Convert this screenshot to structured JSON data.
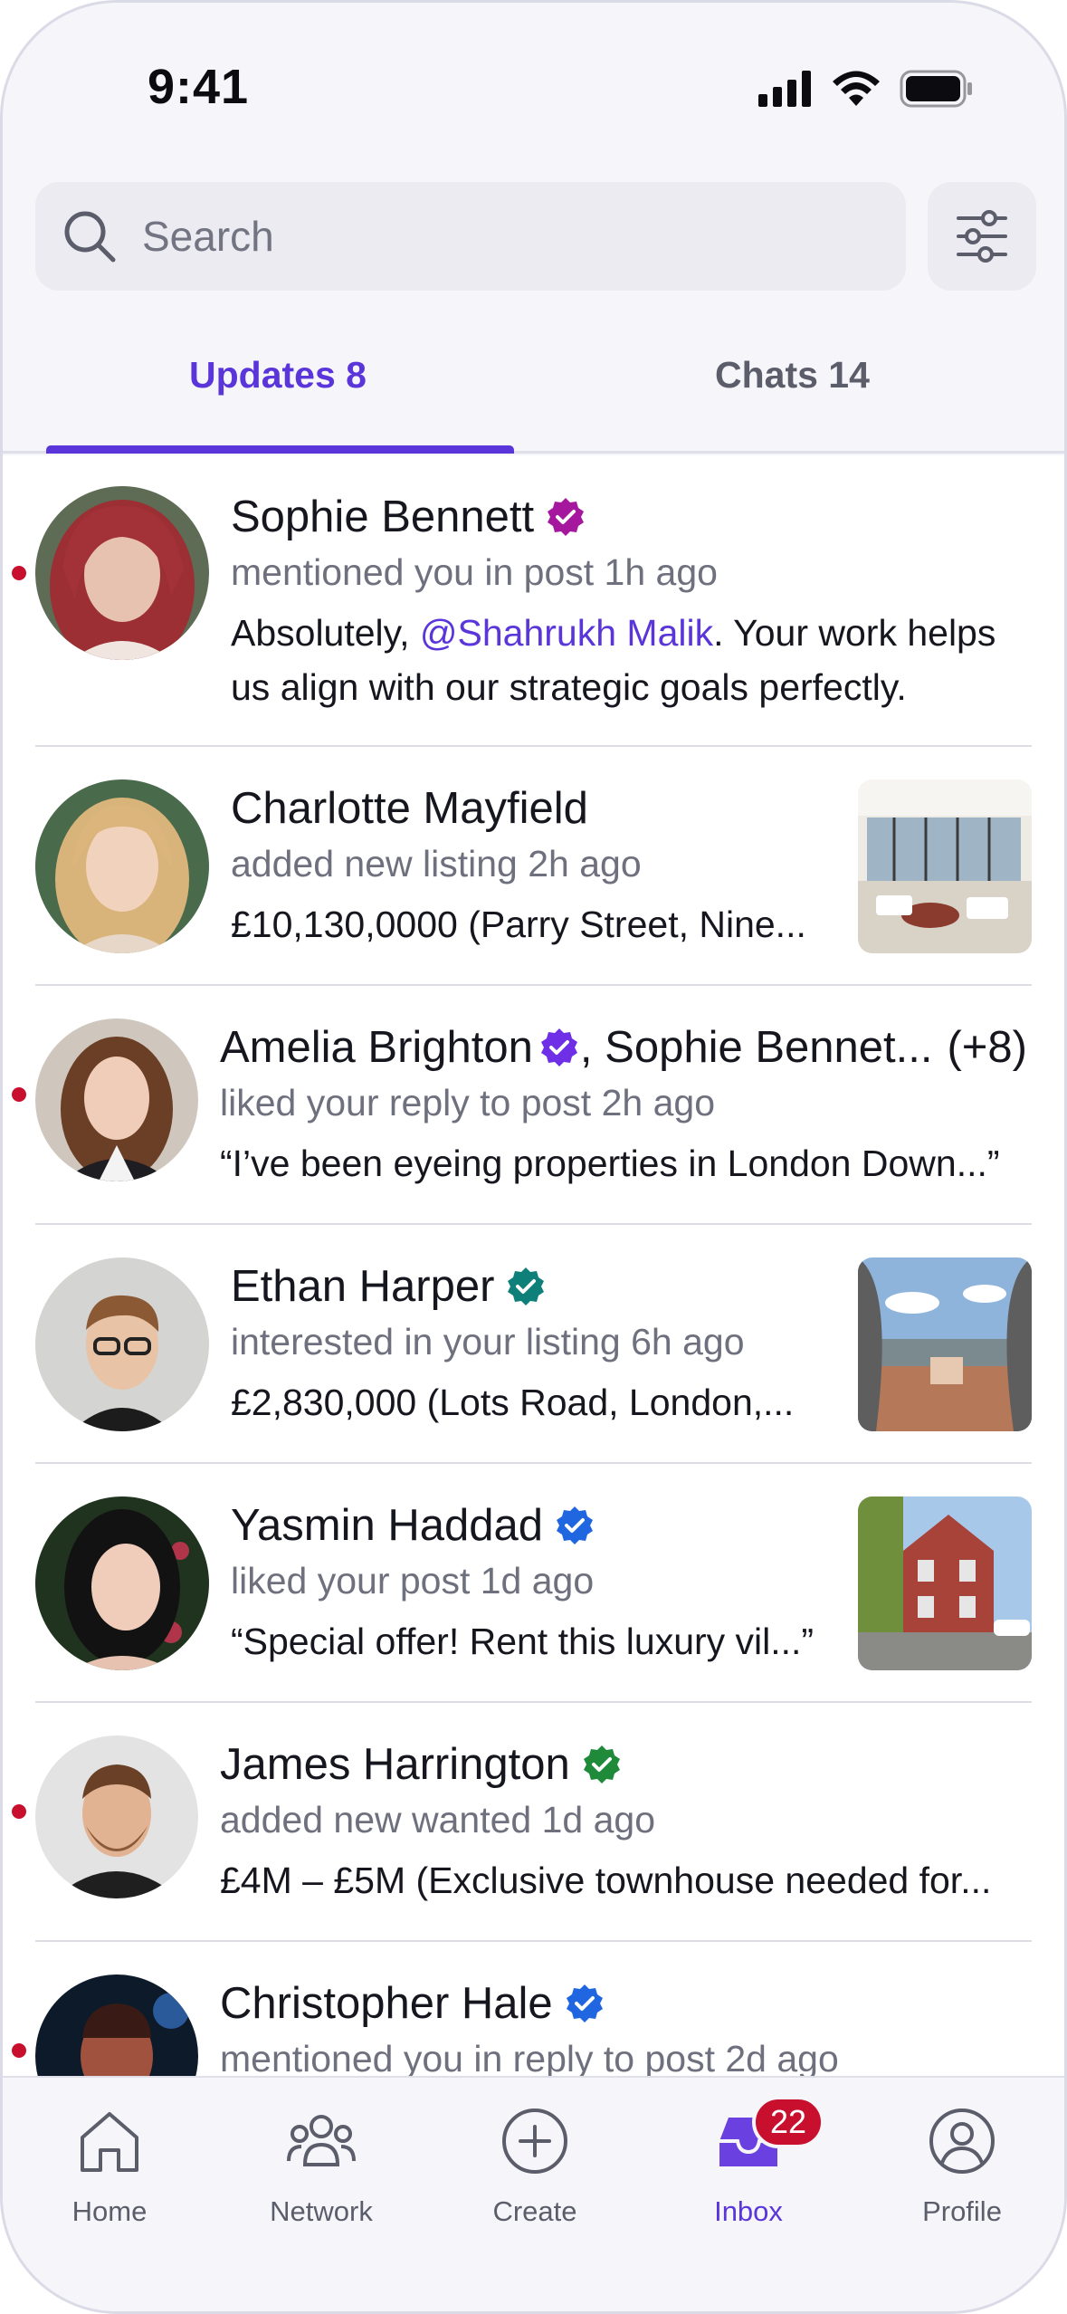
{
  "status_bar": {
    "time": "9:41"
  },
  "search": {
    "placeholder": "Search"
  },
  "tabs": [
    {
      "label": "Updates 8",
      "active": true
    },
    {
      "label": "Chats 14",
      "active": false
    }
  ],
  "notifications": [
    {
      "name": "Sophie Bennett",
      "badge_color": "#a5189e",
      "activity": "mentioned you in post 1h ago",
      "preview_before": "Absolutely, ",
      "mention": "@Shahrukh Malik",
      "preview_after": ". Your work helps us align with our strategic goals perfectly.",
      "unread": true
    },
    {
      "name": "Charlotte Mayfield",
      "activity": "added new listing 2h ago",
      "preview": "£10,130,0000 (Parry Street, Nine...",
      "unread": false,
      "thumbnail": "listing-interior"
    },
    {
      "name": "Amelia Brighton",
      "badge_color": "#6e2fe6",
      "name_suffix": ", Sophie Bennet...",
      "extra_count": "(+8)",
      "activity": "liked your reply to post 2h ago",
      "preview": "“I’ve been eyeing properties in London Down...”",
      "unread": true
    },
    {
      "name": "Ethan Harper",
      "badge_color": "#0f7f7a",
      "activity": "interested in your listing 6h ago",
      "preview": "£2,830,000 (Lots Road, London,...",
      "unread": false,
      "thumbnail": "listing-terrace"
    },
    {
      "name": "Yasmin Haddad",
      "badge_color": "#1f66e0",
      "activity": "liked your post 1d ago",
      "preview": "“Special offer! Rent this luxury vil...”",
      "unread": false,
      "thumbnail": "listing-house"
    },
    {
      "name": "James Harrington",
      "badge_color": "#1e8a3a",
      "activity": "added new wanted 1d ago",
      "preview": "£4M – £5M (Exclusive townhouse needed for...",
      "unread": true
    },
    {
      "name": "Christopher Hale",
      "badge_color": "#1f66e0",
      "activity": "mentioned you in reply to post 2d ago",
      "unread": true
    }
  ],
  "tabbar": [
    {
      "label": "Home",
      "icon": "home-icon"
    },
    {
      "label": "Network",
      "icon": "network-icon"
    },
    {
      "label": "Create",
      "icon": "plus-circle-icon"
    },
    {
      "label": "Inbox",
      "icon": "inbox-icon",
      "active": true,
      "badge": "22"
    },
    {
      "label": "Profile",
      "icon": "profile-icon"
    }
  ],
  "colors": {
    "accent": "#5a35d9",
    "unread": "#c8102e",
    "muted": "#6e707e"
  }
}
